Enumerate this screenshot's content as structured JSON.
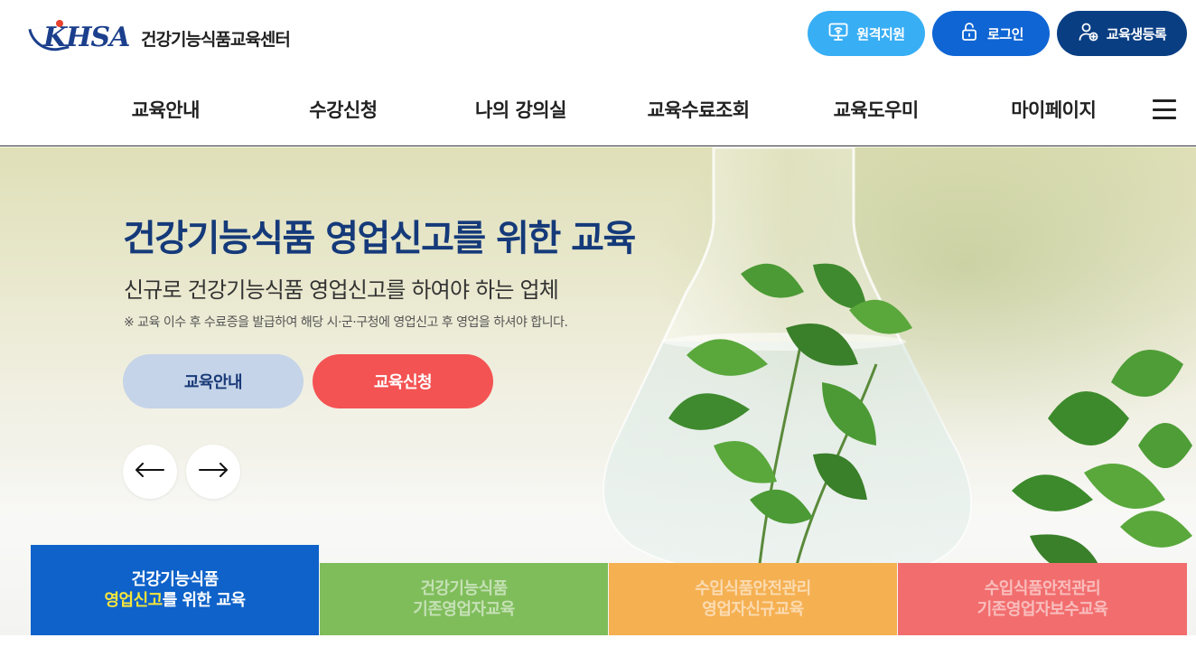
{
  "header": {
    "logo_text": "KHSA",
    "site_name": "건강기능식품교육센터",
    "top_buttons": {
      "remote_label": "원격지원",
      "login_label": "로그인",
      "register_label": "교육생등록"
    },
    "nav": [
      "교육안내",
      "수강신청",
      "나의 강의실",
      "교육수료조회",
      "교육도우미",
      "마이페이지"
    ]
  },
  "hero": {
    "title": "건강기능식품 영업신고를 위한 교육",
    "subtitle": "신규로 건강기능식품 영업신고를 하여야 하는 업체",
    "note": "※ 교육 이수 후 수료증을 발급하여 해당 시·군·구청에 영업신고 후 영업을 하셔야 합니다.",
    "info_button": "교육안내",
    "apply_button": "교육신청"
  },
  "categories": [
    {
      "line1": "건강기능식품",
      "line2_highlight": "영업신고",
      "line2_rest": "를 위한 교육"
    },
    {
      "line1": "건강기능식품",
      "line2": "기존영업자교육"
    },
    {
      "line1": "수입식품안전관리",
      "line2": "영업자신규교육"
    },
    {
      "line1": "수입식품안전관리",
      "line2": "기존영업자보수교육"
    }
  ],
  "colors": {
    "brand_navy": "#153a7a",
    "remote_button": "#38aef5",
    "login_button": "#0f65d4",
    "register_button": "#093e83",
    "apply_button": "#f45353",
    "info_button": "#c5d4e8",
    "tab_active": "#0e62c9",
    "tab_green": "#7fbd5b",
    "tab_orange": "#f5b052",
    "tab_red": "#f26e6e"
  },
  "icons": {
    "remote": "monitor-wifi-icon",
    "login": "lock-icon",
    "register": "user-add-icon",
    "menu": "hamburger-icon",
    "prev": "arrow-left-icon",
    "next": "arrow-right-icon"
  }
}
